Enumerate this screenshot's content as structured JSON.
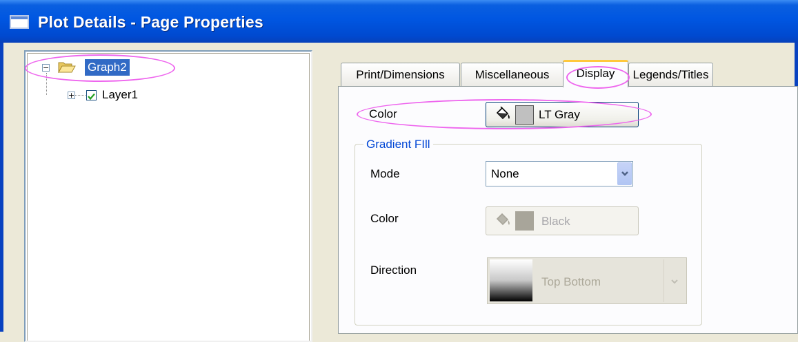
{
  "window": {
    "title": "Plot Details - Page Properties"
  },
  "tree": {
    "root": {
      "label": "Graph2",
      "expander": "−"
    },
    "child": {
      "label": "Layer1",
      "expander": "+",
      "checked": true
    }
  },
  "tabs": [
    {
      "label": "Print/Dimensions"
    },
    {
      "label": "Miscellaneous"
    },
    {
      "label": "Display"
    },
    {
      "label": "Legends/Titles"
    }
  ],
  "display": {
    "color": {
      "label": "Color",
      "value": "LT Gray",
      "swatch": "#C0C0C0"
    },
    "gradient_fill": {
      "title": "Gradient FIll",
      "mode": {
        "label": "Mode",
        "value": "None"
      },
      "color": {
        "label": "Color",
        "value": "Black",
        "swatch": "#A8A59A"
      },
      "direction": {
        "label": "Direction",
        "value": "Top Bottom"
      }
    }
  },
  "icons": {
    "fill_bucket": "paint-bucket-icon",
    "folder": "folder-open-icon",
    "dropdown": "chevron-down-icon"
  },
  "colors": {
    "highlight_ellipse": "#EE66EE",
    "selection": "#316AC5",
    "titlebar": "#0054E3",
    "active_tab_accent": "#FFC83C",
    "group_title": "#0046D5"
  }
}
